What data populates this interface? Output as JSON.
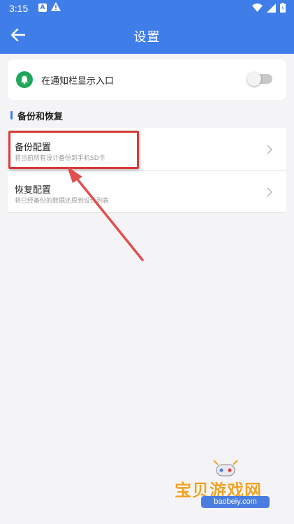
{
  "status_bar": {
    "time": "3:15",
    "notif_letter": "A"
  },
  "header": {
    "title": "设置"
  },
  "notification_setting": {
    "label": "在通知栏显示入口",
    "enabled": false
  },
  "section": {
    "title": "备份和恢复"
  },
  "items": [
    {
      "title": "备份配置",
      "subtitle": "将当前所有设计备份到手机SD卡"
    },
    {
      "title": "恢复配置",
      "subtitle": "将已经备份的数据还原到设计列表"
    }
  ],
  "watermark": {
    "name": "宝贝游戏网",
    "url": "baobeiy.com"
  },
  "colors": {
    "primary": "#3f7ee8",
    "highlight": "#d93a37",
    "bell": "#1fa85c"
  }
}
